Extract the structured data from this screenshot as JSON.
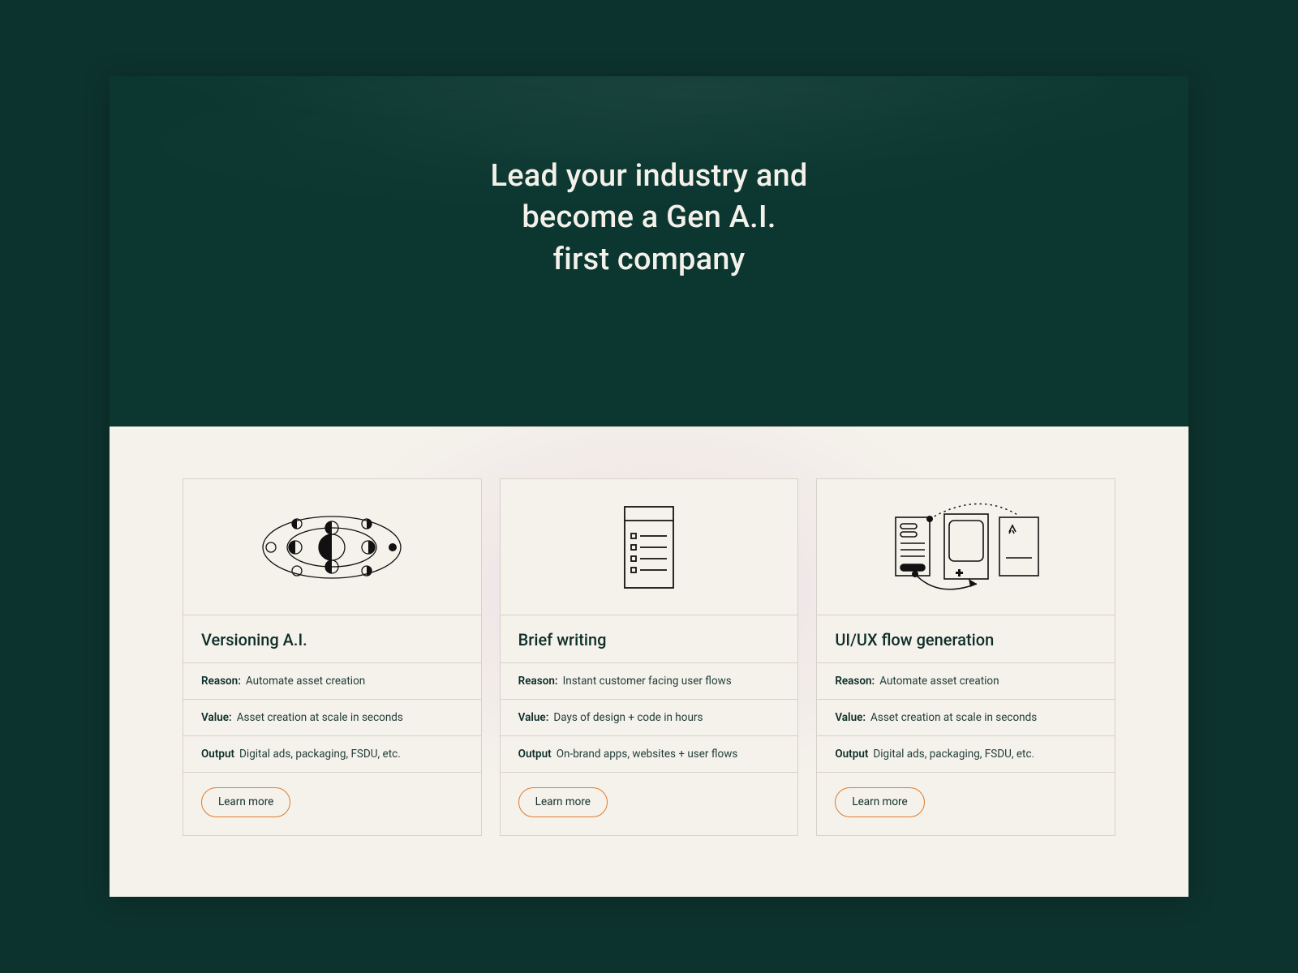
{
  "hero": {
    "line1": "Lead your industry and",
    "line2": "become a Gen A.I.",
    "line3": "first company"
  },
  "labels": {
    "reason": "Reason:",
    "value": "Value:",
    "output": "Output"
  },
  "cards": [
    {
      "title": "Versioning A.I.",
      "reason": "Automate asset creation",
      "value": "Asset creation at scale in seconds",
      "output": "Digital ads, packaging, FSDU, etc.",
      "cta": "Learn more"
    },
    {
      "title": "Brief writing",
      "reason": "Instant customer facing user flows",
      "value": "Days of design + code in hours",
      "output": "On-brand apps, websites + user flows",
      "cta": "Learn more"
    },
    {
      "title": "UI/UX flow generation",
      "reason": "Automate asset creation",
      "value": "Asset creation at scale in seconds",
      "output": "Digital ads, packaging, FSDU, etc.",
      "cta": "Learn more"
    }
  ]
}
